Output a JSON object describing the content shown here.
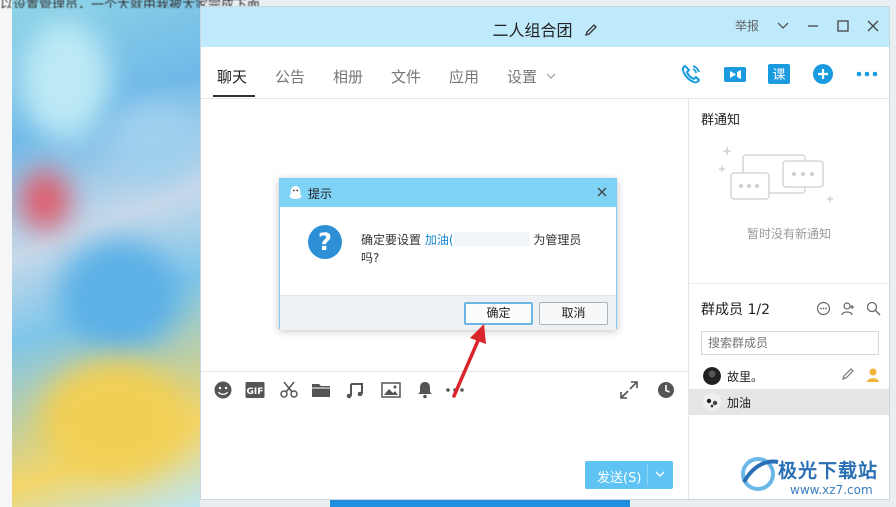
{
  "background": {
    "top_text": "以设置管理员，一个大就由我被大家完成下面"
  },
  "window": {
    "title": "二人组合团",
    "report_label": "举报",
    "tabs": [
      {
        "label": "聊天"
      },
      {
        "label": "公告"
      },
      {
        "label": "相册"
      },
      {
        "label": "文件"
      },
      {
        "label": "应用"
      },
      {
        "label": "设置"
      }
    ],
    "active_tab": "聊天"
  },
  "notice": {
    "title": "群通知",
    "empty_text": "暂时没有新通知"
  },
  "members": {
    "title": "群成员 1/2",
    "search_placeholder": "搜索群成员",
    "list": [
      {
        "name": "故里。"
      },
      {
        "name": "加油"
      }
    ]
  },
  "composer": {
    "send_label": "发送(S)"
  },
  "dialog": {
    "title": "提示",
    "message_prefix": "确定要设置 ",
    "member_name": "加油(",
    "message_suffix": " 为管理员",
    "message_end": "吗?",
    "confirm_label": "确定",
    "cancel_label": "取消"
  },
  "watermark": {
    "text": "极光下载站",
    "url": "www.xz7.com"
  },
  "colors": {
    "accent": "#1a86d0",
    "titlebar": "#bfeafb",
    "dialog_header": "#7fd3f7",
    "send_button": "#5fc4f3",
    "arrow": "#d9262a"
  }
}
